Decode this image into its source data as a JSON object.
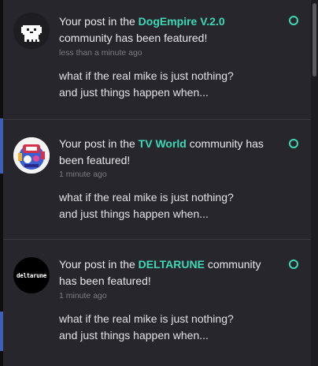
{
  "notifications": [
    {
      "prefix": "Your post in the ",
      "community": "DogEmpire V.2.0",
      "suffix": " community has been featured!",
      "time": "less than a minute ago",
      "body_line1": "what if the real mike is just nothing?",
      "body_line2": "and just things happen when...",
      "avatar_icon": "dog-pixel-avatar-icon"
    },
    {
      "prefix": "Your post in the ",
      "community": "TV World",
      "suffix": " community has been featured!",
      "time": "1 minute ago",
      "body_line1": "what if the real mike is just nothing?",
      "body_line2": "and just things happen when...",
      "avatar_icon": "tv-world-avatar-icon"
    },
    {
      "prefix": "Your post in the ",
      "community": "DELTARUNE",
      "suffix": " community has been featured!",
      "time": "1 minute ago",
      "body_line1": "what if the real mike is just nothing?",
      "body_line2": "and just things happen when...",
      "avatar_icon": "deltarune-avatar-icon",
      "avatar_text": "deltarune"
    }
  ],
  "colors": {
    "accent": "#3dd9b7",
    "panel_bg": "#27262c",
    "text": "#e8e8ec",
    "muted": "#7c7b84"
  }
}
